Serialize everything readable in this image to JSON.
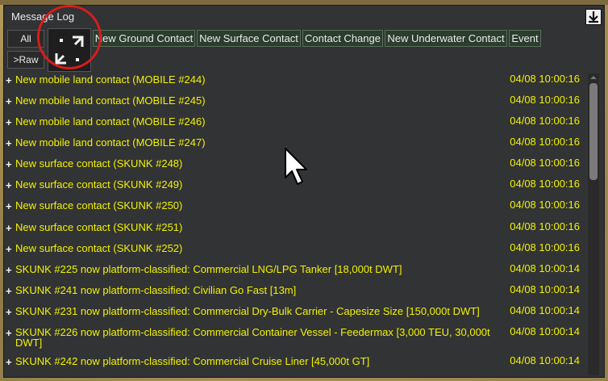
{
  "window": {
    "title": "Message Log"
  },
  "toolbar": {
    "all_label": "All",
    "raw_label": ">Raw",
    "filters": [
      "New Ground Contact",
      "New Surface Contact",
      "Contact Change",
      "New Underwater Contact",
      "Event"
    ]
  },
  "messages": [
    {
      "text": "New mobile land contact (MOBILE #244)",
      "time": "04/08 10:00:16"
    },
    {
      "text": "New mobile land contact (MOBILE #245)",
      "time": "04/08 10:00:16"
    },
    {
      "text": "New mobile land contact (MOBILE #246)",
      "time": "04/08 10:00:16"
    },
    {
      "text": "New mobile land contact (MOBILE #247)",
      "time": "04/08 10:00:16"
    },
    {
      "text": "New surface contact (SKUNK #248)",
      "time": "04/08 10:00:16"
    },
    {
      "text": "New surface contact (SKUNK #249)",
      "time": "04/08 10:00:16"
    },
    {
      "text": "New surface contact (SKUNK #250)",
      "time": "04/08 10:00:16"
    },
    {
      "text": "New surface contact (SKUNK #251)",
      "time": "04/08 10:00:16"
    },
    {
      "text": "New surface contact (SKUNK #252)",
      "time": "04/08 10:00:16"
    },
    {
      "text": "SKUNK #225 now platform-classified: Commercial LNG/LPG Tanker [18,000t DWT]",
      "time": "04/08 10:00:14"
    },
    {
      "text": "SKUNK #241 now platform-classified: Civilian Go Fast [13m]",
      "time": "04/08 10:00:14"
    },
    {
      "text": "SKUNK #231 now platform-classified: Commercial Dry-Bulk Carrier - Capesize Size [150,000t DWT]",
      "time": "04/08 10:00:14"
    },
    {
      "text": "SKUNK #226 now platform-classified: Commercial Container Vessel - Feedermax [3,000 TEU, 30,000t DWT]",
      "time": "04/08 10:00:14"
    },
    {
      "text": "SKUNK #242 now platform-classified: Commercial Cruise Liner [45,000t GT]",
      "time": "04/08 10:00:14"
    }
  ],
  "colors": {
    "message_text": "#f2f200",
    "panel_bg": "#313335",
    "filter_bg": "#2b3d2d",
    "annotation": "#d81c1c"
  },
  "icons": {
    "expand": "expand-arrows-icon",
    "download": "download-arrow-icon",
    "plus": "plus-icon",
    "cursor": "mouse-pointer-icon"
  }
}
